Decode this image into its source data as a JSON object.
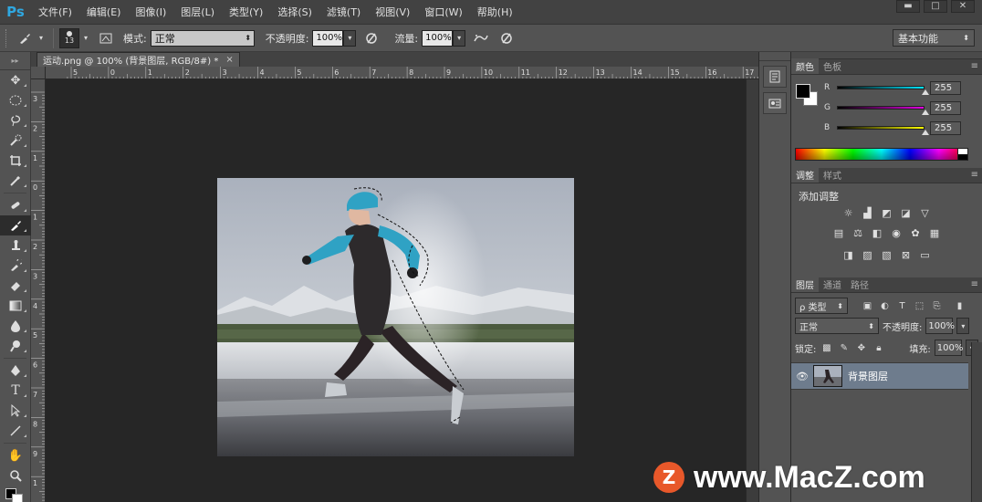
{
  "app": {
    "logo": "Ps"
  },
  "menu": [
    "文件(F)",
    "编辑(E)",
    "图像(I)",
    "图层(L)",
    "类型(Y)",
    "选择(S)",
    "滤镜(T)",
    "视图(V)",
    "窗口(W)",
    "帮助(H)"
  ],
  "window_controls": {
    "minimize": "▬",
    "restore": "□",
    "close": "✕"
  },
  "options": {
    "brush_size": "13",
    "mode_label": "模式:",
    "mode_value": "正常",
    "opacity_label": "不透明度:",
    "opacity_value": "100%",
    "flow_label": "流量:",
    "flow_value": "100%",
    "workspace": "基本功能"
  },
  "document": {
    "tab_title": "运动.png @ 100% (背景图层, RGB/8#) *",
    "ruler_h": [
      "5",
      "0",
      "1",
      "2",
      "3",
      "4",
      "5",
      "6",
      "7",
      "8",
      "9",
      "10",
      "11",
      "12",
      "13",
      "14",
      "15",
      "16",
      "17"
    ],
    "ruler_v": [
      "3",
      "2",
      "1",
      "0",
      "1",
      "2",
      "3",
      "4",
      "5",
      "6",
      "7",
      "8",
      "9",
      "1"
    ]
  },
  "color_panel": {
    "tabs": [
      "颜色",
      "色板"
    ],
    "r_label": "R",
    "r_value": "255",
    "g_label": "G",
    "g_value": "255",
    "b_label": "B",
    "b_value": "255",
    "colors": {
      "r": "#00e5ff",
      "g": "#e100e1",
      "b": "#ffff00"
    }
  },
  "adjust_panel": {
    "tabs": [
      "调整",
      "样式"
    ],
    "title": "添加调整"
  },
  "layers_panel": {
    "tabs": [
      "图层",
      "通道",
      "路径"
    ],
    "filter": "ρ 类型",
    "blend_mode": "正常",
    "opacity_label": "不透明度:",
    "opacity_value": "100%",
    "lock_label": "锁定:",
    "fill_label": "填充:",
    "fill_value": "100%",
    "layer_name": "背景图层"
  },
  "watermark": {
    "logo": "Z",
    "text": "www.MacZ.com"
  }
}
